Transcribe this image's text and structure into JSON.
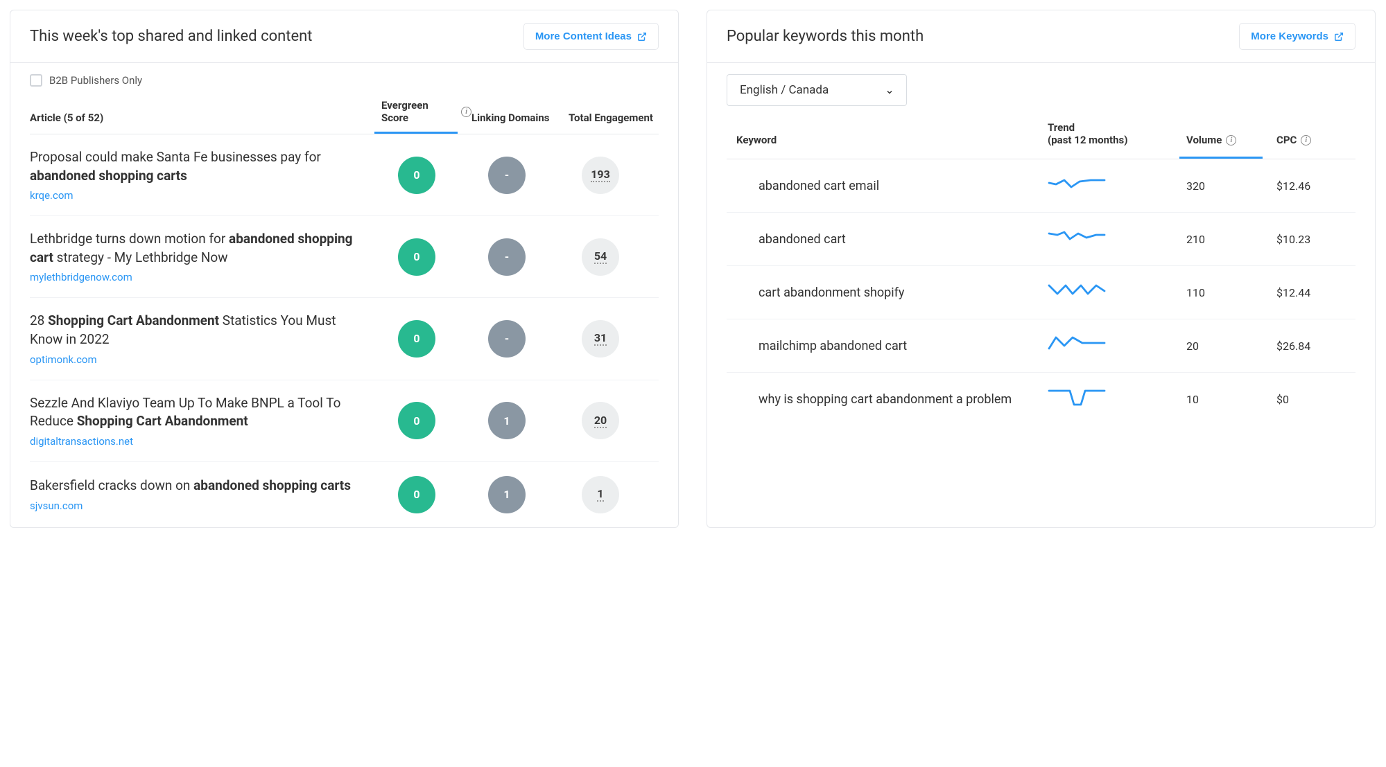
{
  "content": {
    "title": "This week's top shared and linked content",
    "action": "More Content Ideas",
    "filterLabel": "B2B Publishers Only",
    "columns": {
      "article": "Article (5 of 52)",
      "evergreen": "Evergreen Score",
      "linking": "Linking Domains",
      "engagement": "Total Engagement"
    },
    "rows": [
      {
        "titlePre": "Proposal could make Santa Fe businesses pay for ",
        "titleBold": "abandoned shopping carts",
        "titlePost": "",
        "domain": "krqe.com",
        "evergreen": "0",
        "linking": "-",
        "engagement": "193"
      },
      {
        "titlePre": "Lethbridge turns down motion for ",
        "titleBold": "abandoned shopping cart",
        "titlePost": " strategy - My Lethbridge Now",
        "domain": "mylethbridgenow.com",
        "evergreen": "0",
        "linking": "-",
        "engagement": "54"
      },
      {
        "titlePre": "28 ",
        "titleBold": "Shopping Cart Abandonment",
        "titlePost": " Statistics You Must Know in 2022",
        "domain": "optimonk.com",
        "evergreen": "0",
        "linking": "-",
        "engagement": "31"
      },
      {
        "titlePre": "Sezzle And Klaviyo Team Up To Make BNPL a Tool To Reduce ",
        "titleBold": "Shopping Cart Abandonment",
        "titlePost": "",
        "domain": "digitaltransactions.net",
        "evergreen": "0",
        "linking": "1",
        "engagement": "20"
      },
      {
        "titlePre": "Bakersfield cracks down on ",
        "titleBold": "abandoned shopping carts",
        "titlePost": "",
        "domain": "sjvsun.com",
        "evergreen": "0",
        "linking": "1",
        "engagement": "1"
      }
    ]
  },
  "keywords": {
    "title": "Popular keywords this month",
    "action": "More Keywords",
    "langSelect": "English / Canada",
    "columns": {
      "keyword": "Keyword",
      "trend": "Trend (past 12 months)",
      "trendL1": "Trend",
      "trendL2": "(past 12 months)",
      "volume": "Volume",
      "cpc": "CPC"
    },
    "rows": [
      {
        "keyword": "abandoned cart email",
        "volume": "320",
        "cpc": "$12.46",
        "trend": "0,12 10,14 22,8 32,18 44,10 60,8 80,8"
      },
      {
        "keyword": "abandoned cart",
        "volume": "210",
        "cpc": "$10.23",
        "trend": "0,8 12,10 22,6 30,16 42,8 54,14 68,10 80,10"
      },
      {
        "keyword": "cart abandonment shopify",
        "volume": "110",
        "cpc": "$12.44",
        "trend": "0,6 12,18 24,6 34,18 46,6 56,18 68,6 80,14"
      },
      {
        "keyword": "mailchimp abandoned cart",
        "volume": "20",
        "cpc": "$26.84",
        "trend": "0,20 10,4 22,16 34,4 48,12 64,12 80,12"
      },
      {
        "keyword": "why is shopping cart abandonment a problem",
        "volume": "10",
        "cpc": "$0",
        "trend": "0,4 30,4 36,24 46,24 52,4 80,4"
      }
    ]
  }
}
